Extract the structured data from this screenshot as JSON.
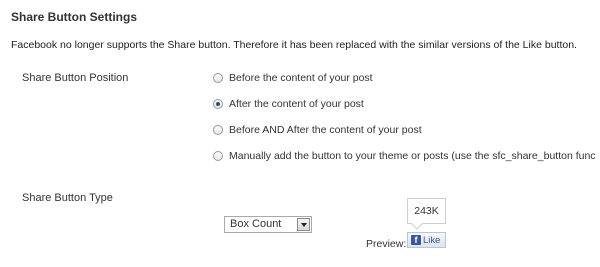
{
  "page": {
    "title": "Share Button Settings",
    "notice": "Facebook no longer supports the Share button. Therefore it has been replaced with the similar versions of the Like button."
  },
  "position_setting": {
    "label": "Share Button Position",
    "options": [
      {
        "label": "Before the content of your post",
        "checked": false
      },
      {
        "label": "After the content of your post",
        "checked": true
      },
      {
        "label": "Before AND After the content of your post",
        "checked": false
      },
      {
        "label": "Manually add the button to your theme or posts (use the sfc_share_button func",
        "checked": false
      }
    ]
  },
  "type_setting": {
    "label": "Share Button Type",
    "selected": "Box Count",
    "preview_label": "Preview:",
    "preview": {
      "count": "243K",
      "icon": "facebook-f-icon",
      "like_label": "Like"
    }
  },
  "colors": {
    "facebook_blue": "#3b5998",
    "radio_checked": "#2b4f8a"
  }
}
